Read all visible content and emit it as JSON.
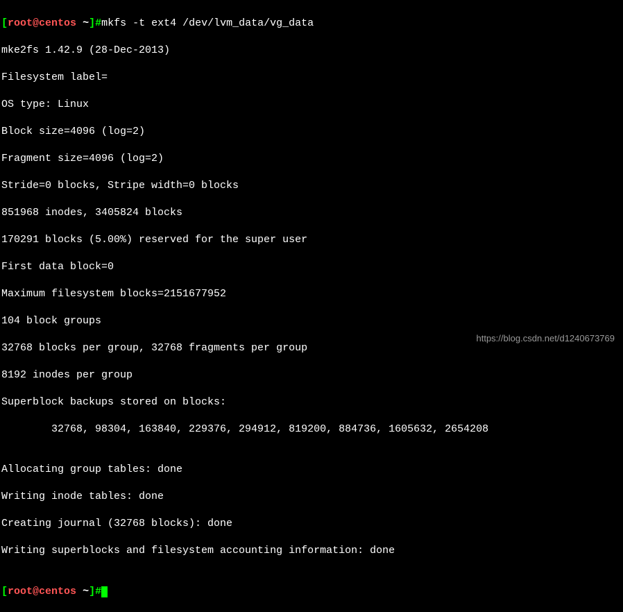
{
  "prompt1": {
    "open": "[",
    "user": "root",
    "at": "@",
    "host": "centos",
    "space": " ",
    "dir": "~",
    "close": "]",
    "hash": "#"
  },
  "command": "mkfs -t ext4 /dev/lvm_data/vg_data",
  "output": {
    "l1": "mke2fs 1.42.9 (28-Dec-2013)",
    "l2": "Filesystem label=",
    "l3": "OS type: Linux",
    "l4": "Block size=4096 (log=2)",
    "l5": "Fragment size=4096 (log=2)",
    "l6": "Stride=0 blocks, Stripe width=0 blocks",
    "l7": "851968 inodes, 3405824 blocks",
    "l8": "170291 blocks (5.00%) reserved for the super user",
    "l9": "First data block=0",
    "l10": "Maximum filesystem blocks=2151677952",
    "l11": "104 block groups",
    "l12": "32768 blocks per group, 32768 fragments per group",
    "l13": "8192 inodes per group",
    "l14": "Superblock backups stored on blocks: ",
    "l15": "        32768, 98304, 163840, 229376, 294912, 819200, 884736, 1605632, 2654208",
    "l16": "",
    "l17": "Allocating group tables: done",
    "l18": "Writing inode tables: done",
    "l19": "Creating journal (32768 blocks): done",
    "l20": "Writing superblocks and filesystem accounting information: done",
    "l21": ""
  },
  "watermark": "https://blog.csdn.net/d1240673769"
}
